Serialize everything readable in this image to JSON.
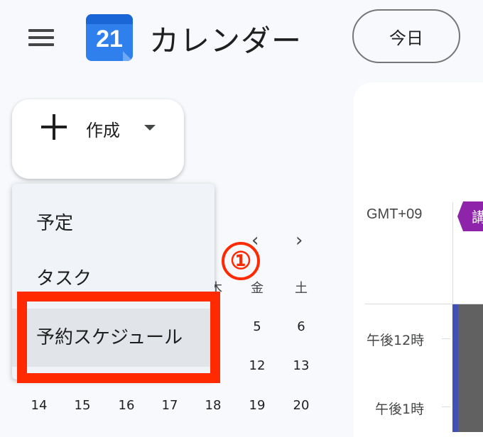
{
  "header": {
    "app_title": "カレンダー",
    "logo_day": "21",
    "today_label": "今日"
  },
  "create": {
    "label": "作成"
  },
  "dropdown": {
    "items": [
      "予定",
      "タスク",
      "予約スケジュール"
    ],
    "selected_index": 2
  },
  "annotation": {
    "step": "①",
    "color": "#ff2a00"
  },
  "mini_calendar": {
    "weekday_partial": "木",
    "weekdays_visible": [
      "金",
      "土"
    ],
    "week_row_2": [
      "5",
      "6"
    ],
    "week_row_3": [
      "12",
      "13"
    ],
    "week_row_4": [
      "14",
      "15",
      "16",
      "17",
      "18",
      "19",
      "20"
    ]
  },
  "main": {
    "timezone": "GMT+09",
    "event_chip_text": "講",
    "times": [
      "午後12時",
      "午後1時"
    ]
  },
  "colors": {
    "event_purple": "#8e24aa",
    "event_blue": "#3f51b5",
    "logo_blue": "#2f80ed"
  },
  "icons": [
    "menu-icon",
    "calendar-logo-icon",
    "plus-icon",
    "caret-down-icon",
    "chevron-left-icon",
    "chevron-right-icon"
  ]
}
